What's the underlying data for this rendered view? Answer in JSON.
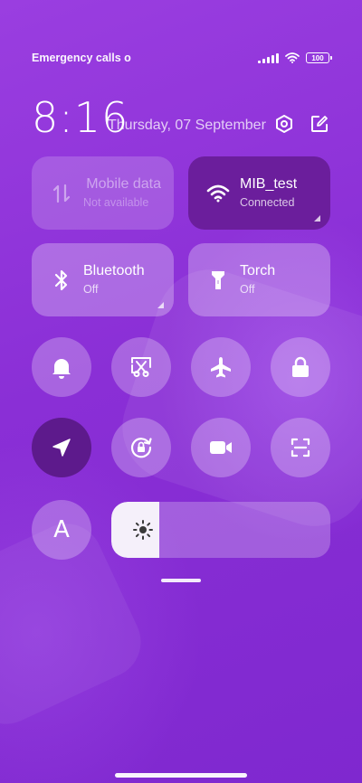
{
  "status_bar": {
    "carrier_text": "Emergency calls o",
    "battery_level": "100"
  },
  "header": {
    "time": "8:16",
    "date": "Thursday, 07 September",
    "settings_icon": "settings-hexagon-icon",
    "edit_icon": "edit-icon"
  },
  "tiles": {
    "mobile_data": {
      "title": "Mobile data",
      "subtitle": "Not available",
      "icon": "mobile-data-icon"
    },
    "wifi": {
      "title": "MIB_test",
      "subtitle": "Connected",
      "icon": "wifi-icon"
    },
    "bluetooth": {
      "title": "Bluetooth",
      "subtitle": "Off",
      "icon": "bluetooth-icon"
    },
    "torch": {
      "title": "Torch",
      "subtitle": "Off",
      "icon": "torch-icon"
    }
  },
  "toggles": [
    {
      "name": "bell",
      "icon": "bell-icon"
    },
    {
      "name": "screenshot",
      "icon": "screenshot-icon"
    },
    {
      "name": "airplane",
      "icon": "airplane-icon"
    },
    {
      "name": "lock",
      "icon": "lock-icon"
    },
    {
      "name": "location",
      "icon": "location-icon",
      "active": true
    },
    {
      "name": "rotation-lock",
      "icon": "rotation-lock-icon"
    },
    {
      "name": "screen-record",
      "icon": "video-camera-icon"
    },
    {
      "name": "scanner",
      "icon": "scan-icon"
    }
  ],
  "font_button": {
    "label": "A"
  },
  "brightness": {
    "level_percent": 22,
    "icon": "brightness-icon"
  },
  "colors": {
    "background": "#8a2fd6",
    "active_tile": "#6b1e9c",
    "active_round": "#5d1a8c"
  }
}
